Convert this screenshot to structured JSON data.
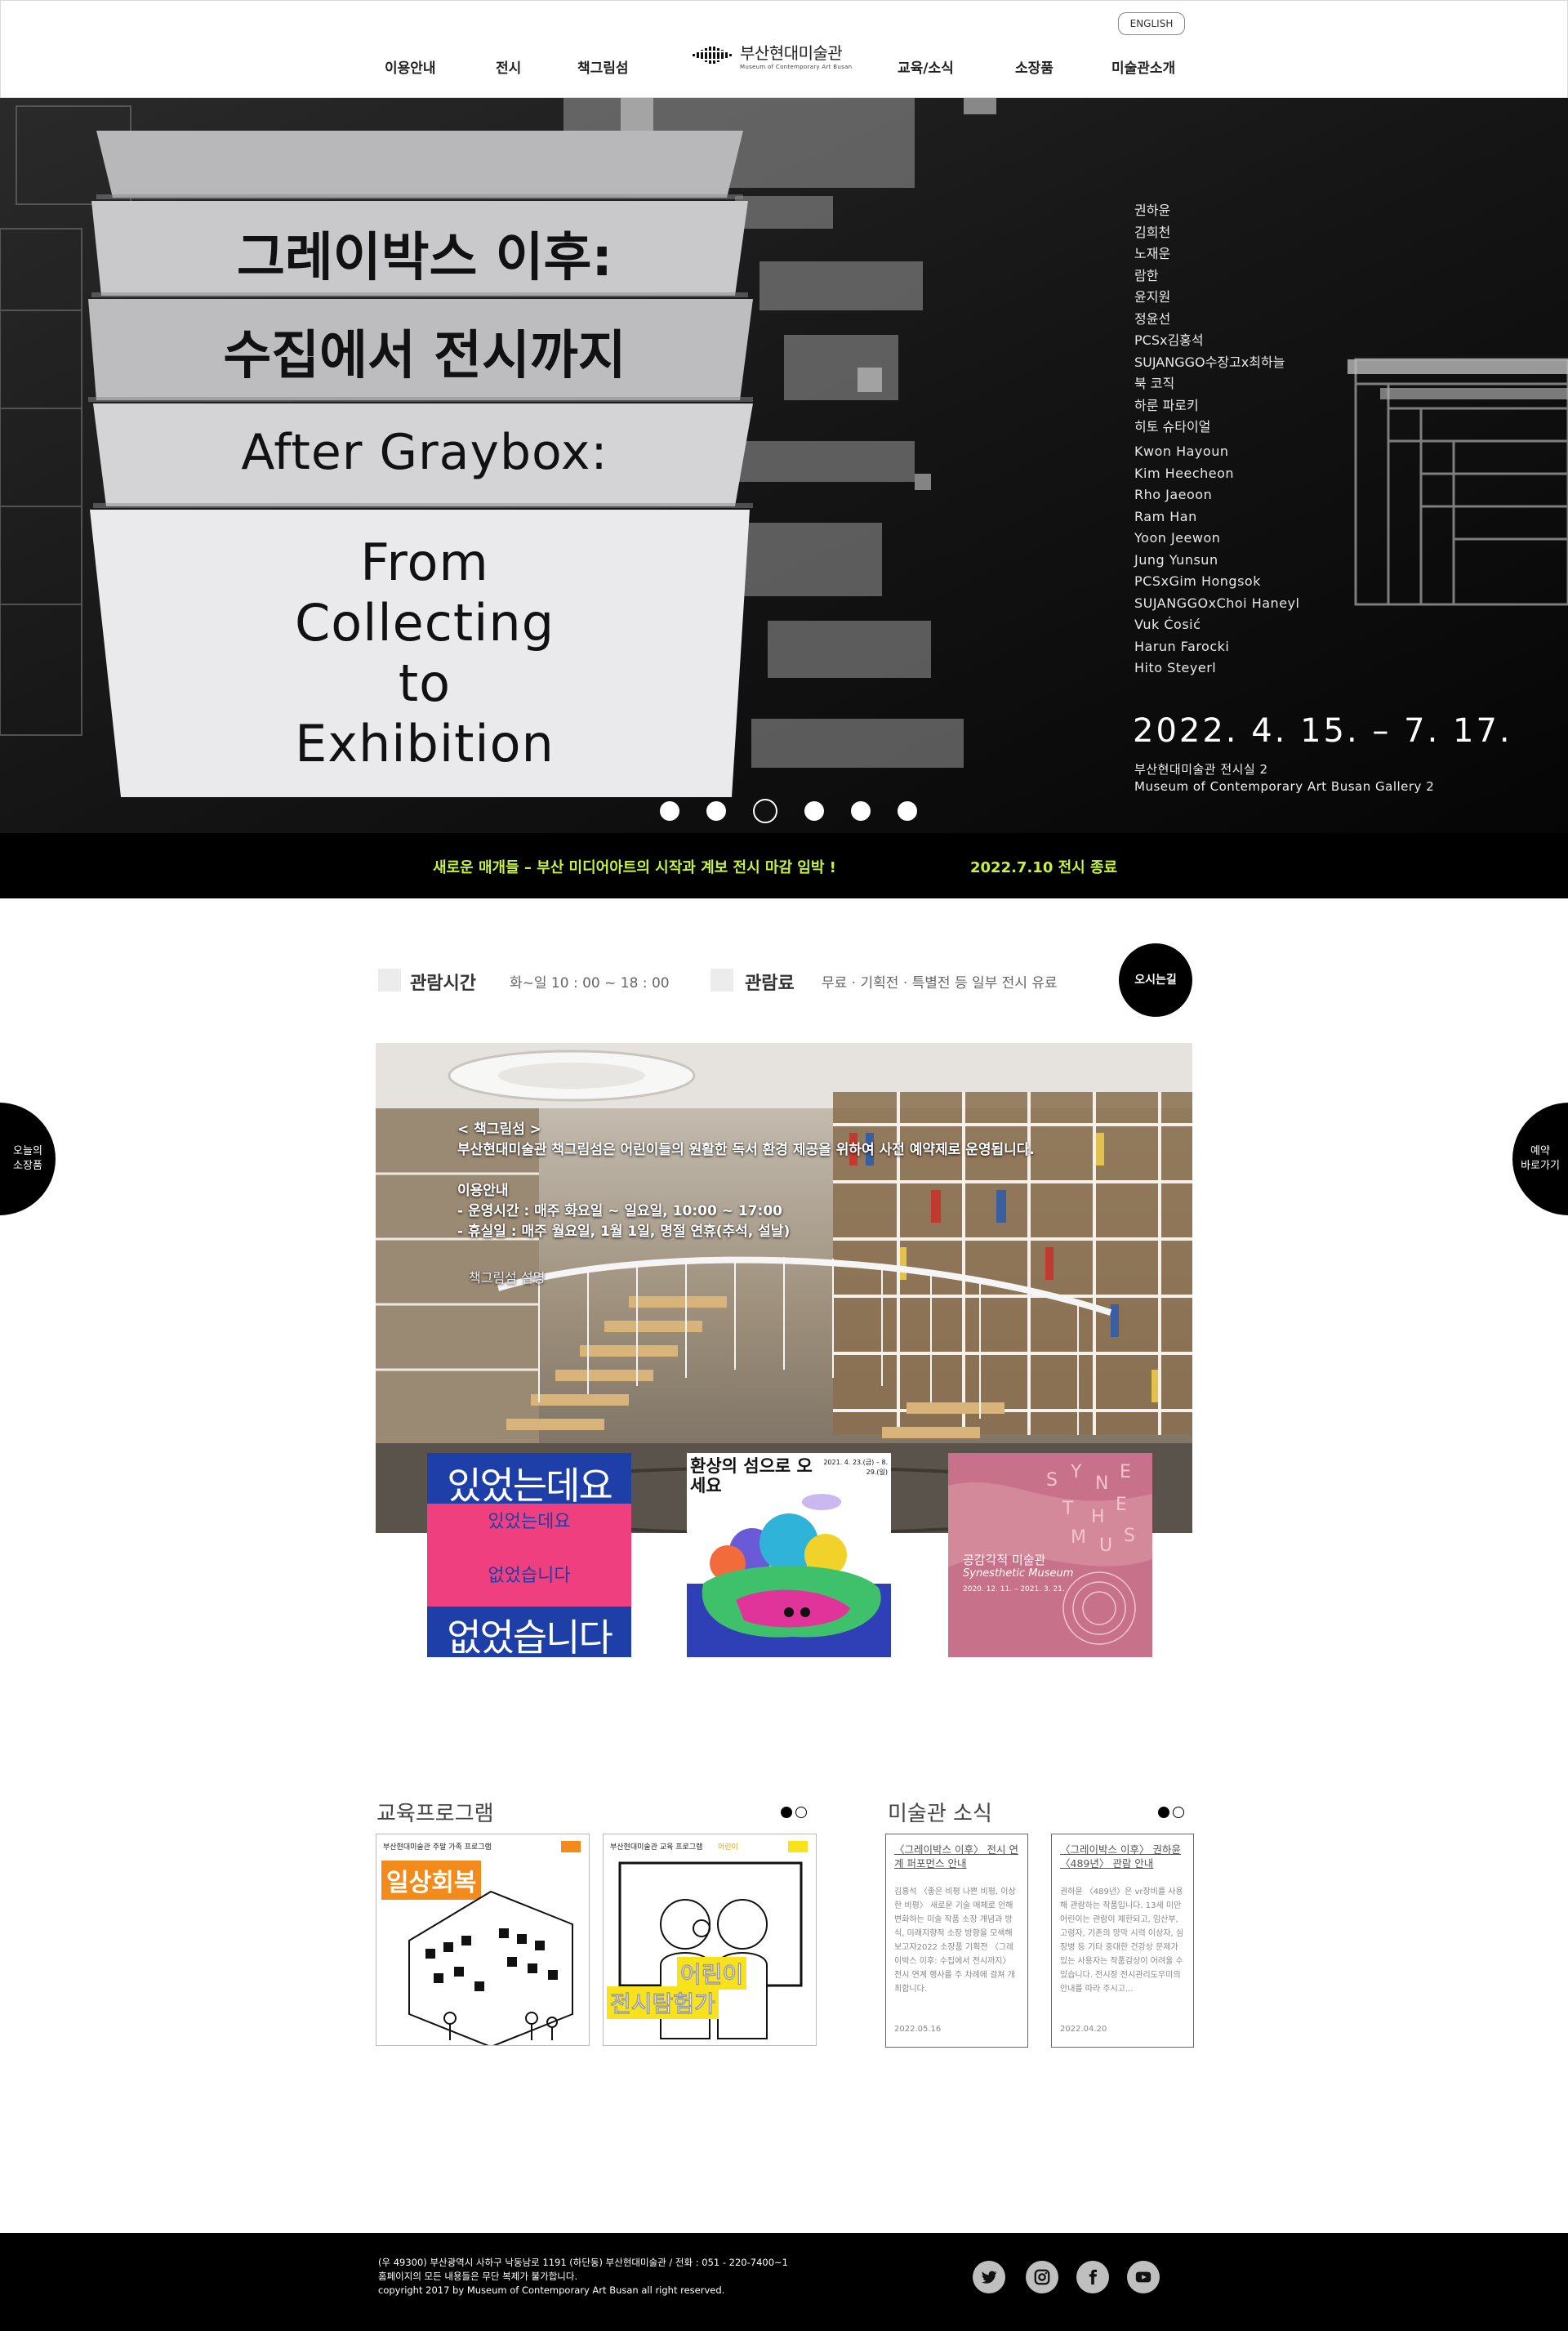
{
  "header": {
    "lang_button": "ENGLISH",
    "nav": [
      "이용안내",
      "전시",
      "책그림섬",
      "교육/소식",
      "소장품",
      "미술관소개"
    ],
    "logo_ko": "부산현대미술관",
    "logo_en": "Museum of Contemporary Art Busan"
  },
  "hero": {
    "slab_lines": [
      "그레이박스 이후:",
      "수집에서 전시까지",
      "After Graybox:",
      "From Collecting to Exhibition"
    ],
    "slab_4_lines": [
      "From",
      "Collecting",
      "to",
      "Exhibition"
    ],
    "artists_ko": [
      "권하윤",
      "김희천",
      "노재운",
      "람한",
      "윤지원",
      "정윤선",
      "PCSx김홍석",
      "SUJANGGO수장고x최하늘",
      "북 코직",
      "하룬 파로키",
      "히토 슈타이얼"
    ],
    "artists_en": [
      "Kwon Hayoun",
      "Kim Heecheon",
      "Rho Jaeoon",
      "Ram Han",
      "Yoon Jeewon",
      "Jung Yunsun",
      "PCSxGim Hongsok",
      "SUJANGGOxChoi Haneyl",
      "Vuk Ćosić",
      "Harun Farocki",
      "Hito Steyerl"
    ],
    "date": "2022. 4. 15. – 7. 17.",
    "venue_ko": "부산현대미술관 전시실 2",
    "venue_en": "Museum of Contemporary Art Busan Gallery 2",
    "slide_count": 6,
    "active_slide": 3
  },
  "ticker": {
    "text": "새로운 매개들 – 부산 미디어아트의 시작과 계보 전시 마감 임박 !",
    "date": "2022.7.10 전시 종료"
  },
  "info": {
    "hours_label": "관람시간",
    "hours_value": "화~일  10 : 00 ~ 18 : 00",
    "fee_label": "관람료",
    "fee_value": "무료 · 기획전 · 특별전 등 일부 전시 유료",
    "directions": "오시는길"
  },
  "side": {
    "left": [
      "오늘의",
      "소장품"
    ],
    "right": [
      "예약",
      "바로가기"
    ]
  },
  "library": {
    "title": "< 책그림섬 >",
    "desc": "부산현대미술관 책그림섬은 어린이들의 원활한 독서 환경 제공을 위하여 사전 예약제로 운영됩니다.",
    "guide_title": "이용안내",
    "hours": " - 운영시간 : 매주 화요일 ~ 일요일, 10:00 ~ 17:00",
    "closed": " - 휴실일 : 매주 월요일, 1월 1일, 명절 연휴(추석, 설날)",
    "link": "책그림섬 설명"
  },
  "posters": {
    "p1_top": "있었는데요",
    "p1_bottom": "없었습니다",
    "p2_title": "환상의 섬으로 오세요",
    "p2_date": "2021. 4. 23.(금) – 8. 29.(일)",
    "p3_title": "공감각적 미술관",
    "p3_subtitle": "Synesthetic Museum",
    "p3_date": "2020. 12. 11. – 2021. 3. 21."
  },
  "education": {
    "title": "교육프로그램",
    "card1_header": "부산현대미술관 주말 가족 프로그램",
    "card1_badge": "일상회복",
    "card2_header": "부산현대미술관 교육 프로그램",
    "card2_tag": "어린이",
    "card2_badge_1": "어린이",
    "card2_badge_2": "전시탐험가"
  },
  "news": {
    "title": "미술관 소식",
    "items": [
      {
        "title": "〈그레이박스 이후〉 전시 연계 퍼포먼스 안내",
        "body": "김홍석 〈좋은 비평 나쁜 비평, 이상한 비평〉 새로운 기술 매체로 인해 변화하는 미술 작품 소장 개념과 방식, 미래지향적 소장 방향을 모색해보고자2022 소장품 기획전 〈그레이박스 이후: 수집에서 전시까지〉 전시 연계 행사를 주 차례에 걸쳐 개최합니다.",
        "date": "2022.05.16"
      },
      {
        "title": "〈그레이박스 이후〉 권하윤 〈489년〉 관람 안내",
        "body": "권하윤 〈489년〉은 vr장비를 사용해 관람하는 작품입니다. 13세 미만 어린이는 관람이 제한되고, 임산부, 고령자, 기존의 망막 시력 이상자, 심장병 등 기타 중대한 건강상 문제가 있는 사용자는 작품감상이 어려울 수 있습니다. 전시장 전시관리도우미의 안내를 따라 주시고...",
        "date": "2022.04.20"
      }
    ]
  },
  "footer": {
    "line1": "(우 49300) 부산광역시 사하구 낙동남로 1191 (하단동) 부산현대미술관 / 전화 : 051 - 220-7400~1",
    "line2": "홈페이지의 모든 내용들은 무단 복제가 불가합니다.",
    "line3": "copyright 2017 by Museum of Contemporary Art Busan all right reserved.",
    "sns": [
      "twitter-icon",
      "instagram-icon",
      "facebook-icon",
      "youtube-icon"
    ]
  },
  "colors": {
    "accent_green": "#c6f23e",
    "black": "#000000",
    "poster_pink": "#ef3f7e",
    "poster_blue": "#1f3fa8",
    "poster_mauve": "#c8718a",
    "edu_orange": "#f28a1c",
    "edu_yellow": "#f8e21c"
  }
}
